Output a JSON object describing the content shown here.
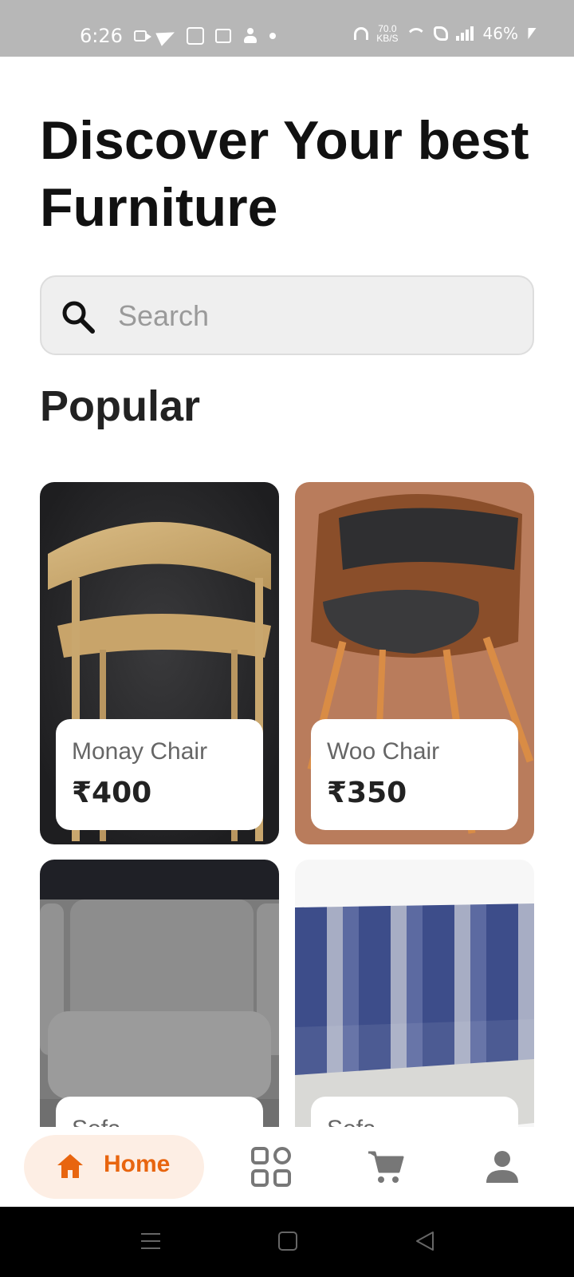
{
  "status_bar": {
    "time": "6:26",
    "speed_value": "70.0",
    "speed_unit": "KB/S",
    "battery": "46%"
  },
  "header": {
    "title": "Discover Your best Furniture"
  },
  "search": {
    "placeholder": "Search"
  },
  "popular": {
    "title": "Popular",
    "items": [
      {
        "name": "Monay Chair",
        "price": "₹400"
      },
      {
        "name": "Woo Chair",
        "price": "₹350"
      },
      {
        "name": "Sofa",
        "price": ""
      },
      {
        "name": "Sofa",
        "price": ""
      }
    ]
  },
  "bottom_nav": {
    "home_label": "Home",
    "accent_color": "#e8650f",
    "icons": [
      "home-icon",
      "grid-icon",
      "cart-icon",
      "profile-icon"
    ]
  }
}
